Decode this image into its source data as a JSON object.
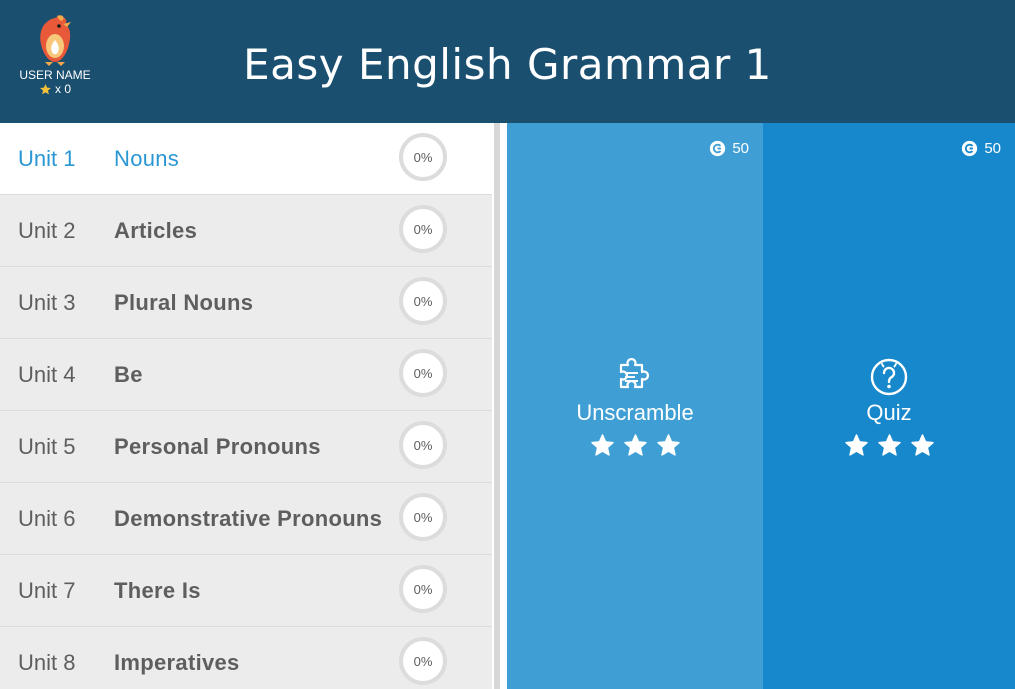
{
  "header": {
    "title": "Easy English Grammar 1",
    "user_name": "USER NAME",
    "star_count": "x 0",
    "avatar_icon": "phoenix-avatar-icon"
  },
  "units": [
    {
      "number": "Unit 1",
      "name": "Nouns",
      "progress": "0%",
      "active": true
    },
    {
      "number": "Unit 2",
      "name": "Articles",
      "progress": "0%",
      "active": false
    },
    {
      "number": "Unit 3",
      "name": "Plural Nouns",
      "progress": "0%",
      "active": false
    },
    {
      "number": "Unit 4",
      "name": "Be",
      "progress": "0%",
      "active": false
    },
    {
      "number": "Unit 5",
      "name": "Personal Pronouns",
      "progress": "0%",
      "active": false
    },
    {
      "number": "Unit 6",
      "name": "Demonstrative Pronouns",
      "progress": "0%",
      "active": false
    },
    {
      "number": "Unit 7",
      "name": "There Is",
      "progress": "0%",
      "active": false
    },
    {
      "number": "Unit 8",
      "name": "Imperatives",
      "progress": "0%",
      "active": false
    }
  ],
  "activities": [
    {
      "label": "Unscramble",
      "points": "50",
      "icon": "puzzle-icon",
      "stars": 3
    },
    {
      "label": "Quiz",
      "points": "50",
      "icon": "question-bulb-icon",
      "stars": 3
    }
  ],
  "colors": {
    "header_bg": "#1a4f70",
    "active_accent": "#2b97d3",
    "unscramble_bg": "#3f9fd5",
    "quiz_bg": "#1788cb",
    "list_bg": "#ececec"
  }
}
